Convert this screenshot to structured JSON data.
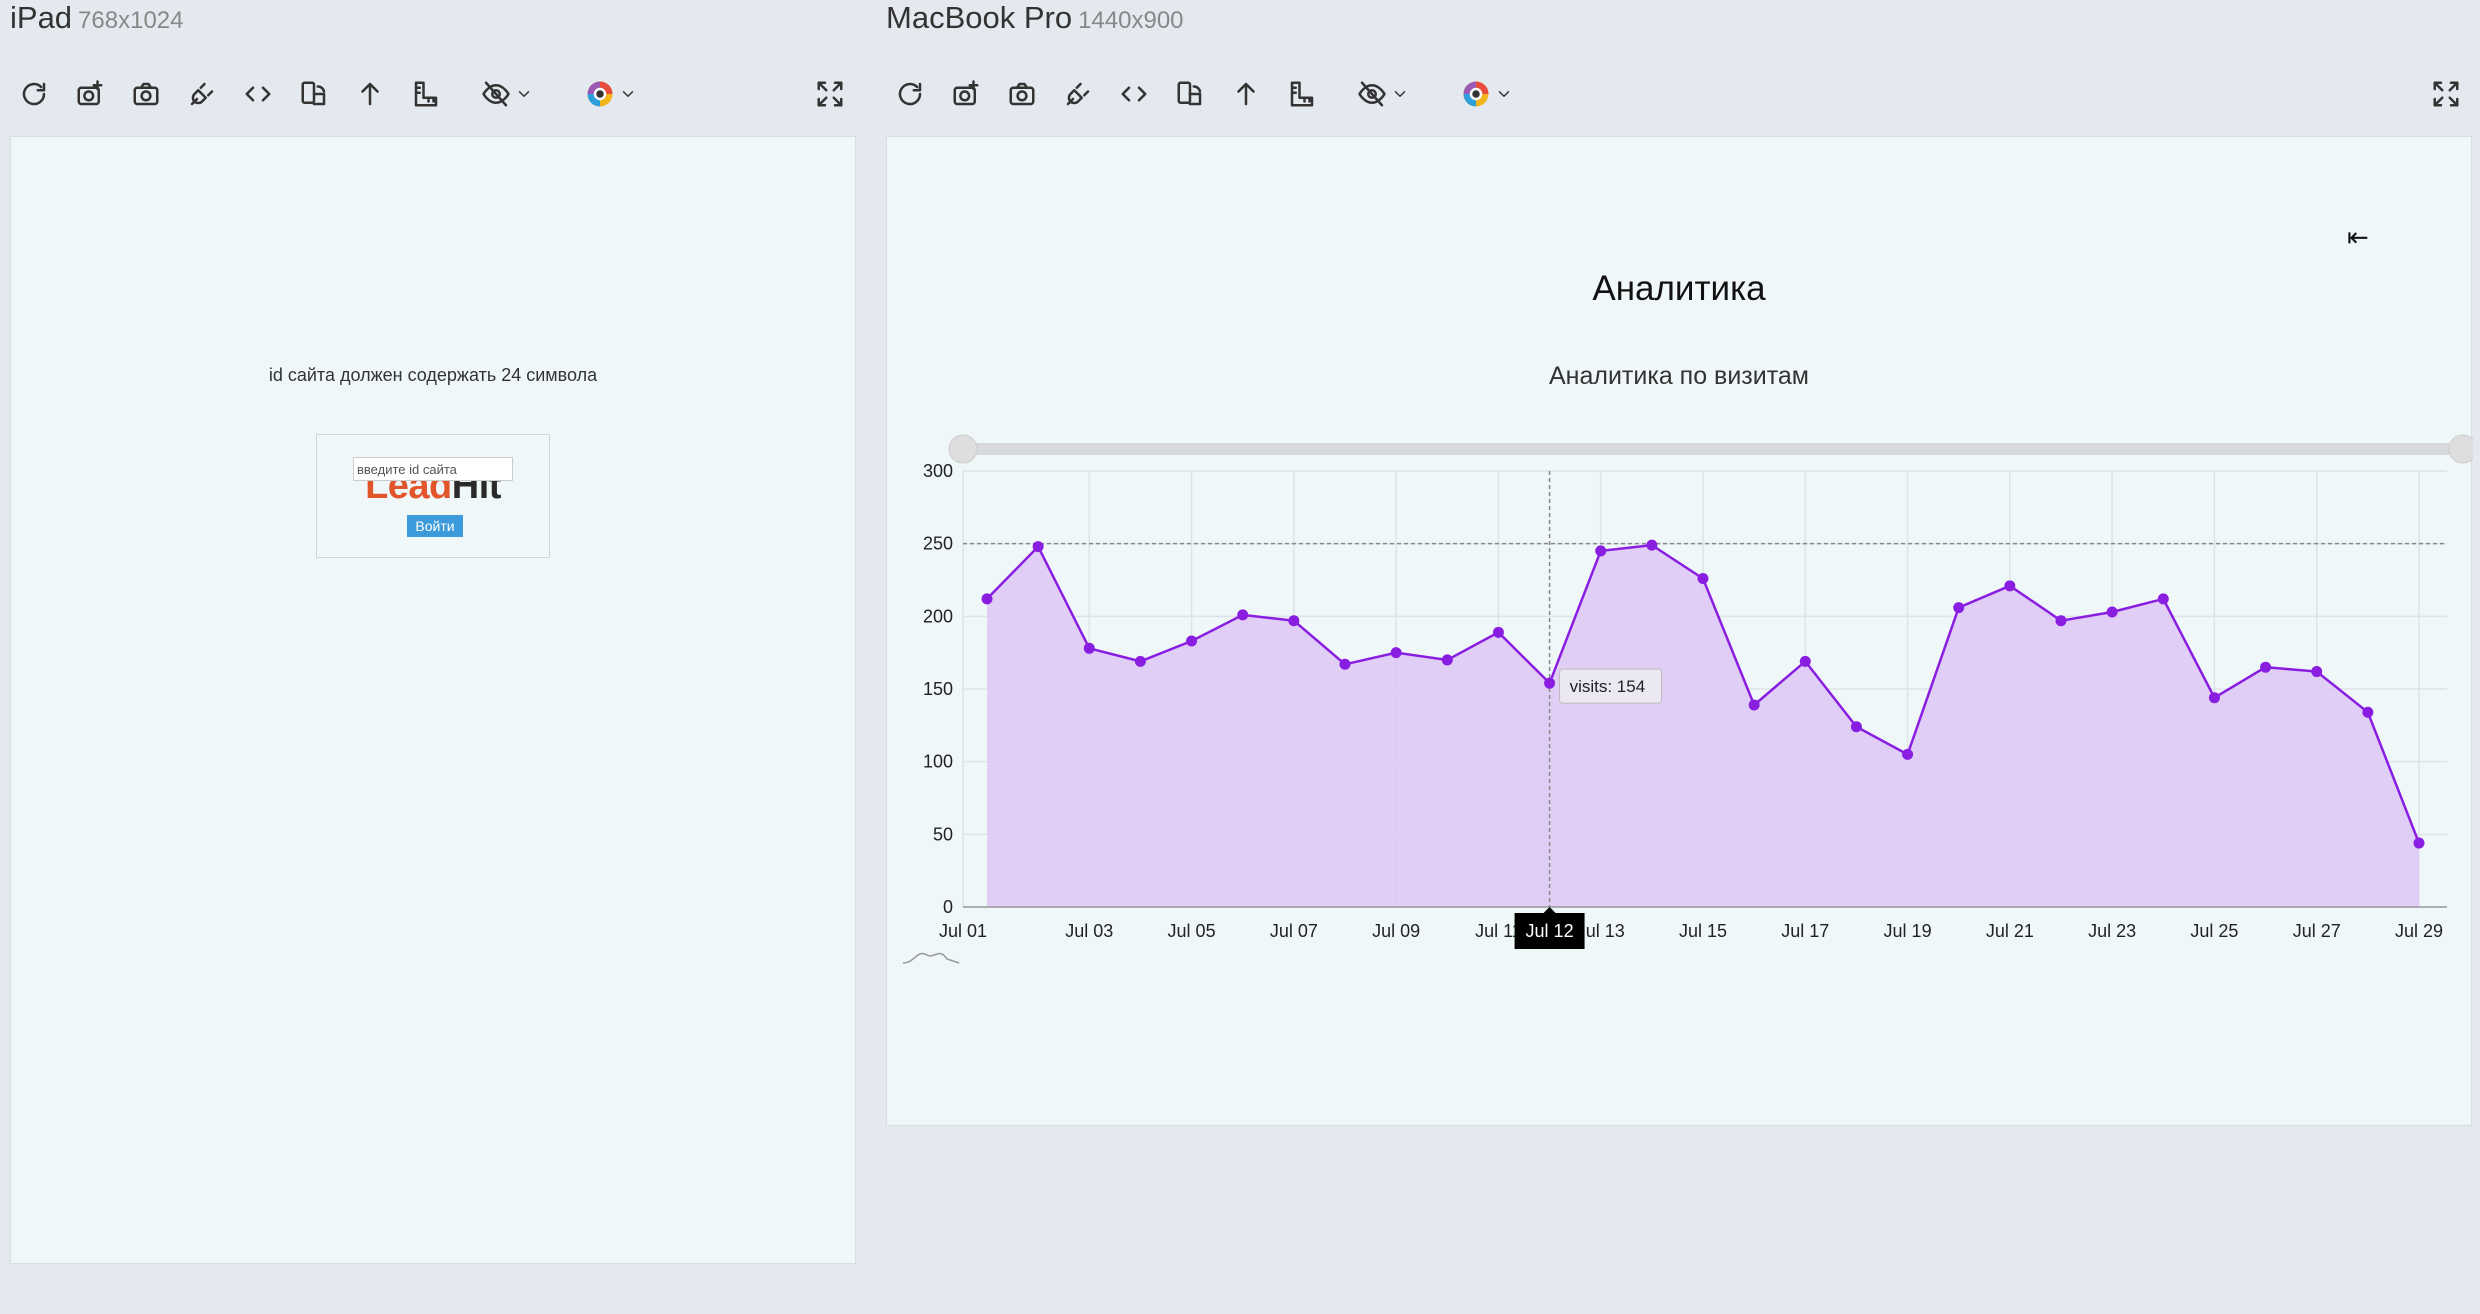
{
  "ipad": {
    "name": "iPad",
    "size": "768x1024"
  },
  "macbook": {
    "name": "MacBook Pro",
    "size": "1440x900"
  },
  "toolbar_icons": [
    "reload-icon",
    "screenshot-edit-icon",
    "camera-icon",
    "plug-icon",
    "code-icon",
    "rotate-device-icon",
    "scroll-top-icon",
    "ruler-icon",
    "eye-slash-icon",
    "chevron-down-icon",
    "color-wheel-icon",
    "chevron-down-icon",
    "fullscreen-icon"
  ],
  "login": {
    "error": "id сайта должен содержать 24 символа",
    "logo_part1": "Lead",
    "logo_part2": "Hit",
    "input_placeholder": "введите id сайта",
    "input_value": "",
    "button": "Войти"
  },
  "analytics": {
    "logout_icon": "⇤",
    "title": "Аналитика",
    "chart_title": "Аналитика по визитам",
    "tooltip": "visits: 154",
    "crosshair_label": "Jul 12"
  },
  "colors": {
    "line": "#8a1ee0",
    "fill": "#dec9f5",
    "logo_red": "#e2552b",
    "button_blue": "#3b9ad9"
  },
  "chart_data": {
    "type": "area",
    "x": [
      "Jul 01",
      "Jul 02",
      "Jul 03",
      "Jul 04",
      "Jul 05",
      "Jul 06",
      "Jul 07",
      "Jul 08",
      "Jul 09",
      "Jul 10",
      "Jul 11",
      "Jul 12",
      "Jul 13",
      "Jul 14",
      "Jul 15",
      "Jul 16",
      "Jul 17",
      "Jul 18",
      "Jul 19",
      "Jul 20",
      "Jul 21",
      "Jul 22",
      "Jul 23",
      "Jul 24",
      "Jul 25",
      "Jul 26",
      "Jul 27",
      "Jul 28",
      "Jul 29"
    ],
    "xticks": [
      "Jul 01",
      "Jul 03",
      "Jul 05",
      "Jul 07",
      "Jul 09",
      "Jul 11",
      "Jul 13",
      "Jul 15",
      "Jul 17",
      "Jul 19",
      "Jul 21",
      "Jul 23",
      "Jul 25",
      "Jul 27",
      "Jul 29"
    ],
    "series": [
      {
        "name": "visits",
        "values": [
          212,
          248,
          178,
          169,
          183,
          201,
          197,
          167,
          175,
          170,
          189,
          154,
          245,
          249,
          226,
          139,
          169,
          124,
          105,
          206,
          221,
          197,
          203,
          212,
          144,
          165,
          162,
          134,
          44
        ]
      }
    ],
    "ylim": [
      0,
      300
    ],
    "yticks": [
      0,
      50,
      100,
      150,
      200,
      250,
      300
    ],
    "grid": true,
    "highlight_index": 11
  }
}
